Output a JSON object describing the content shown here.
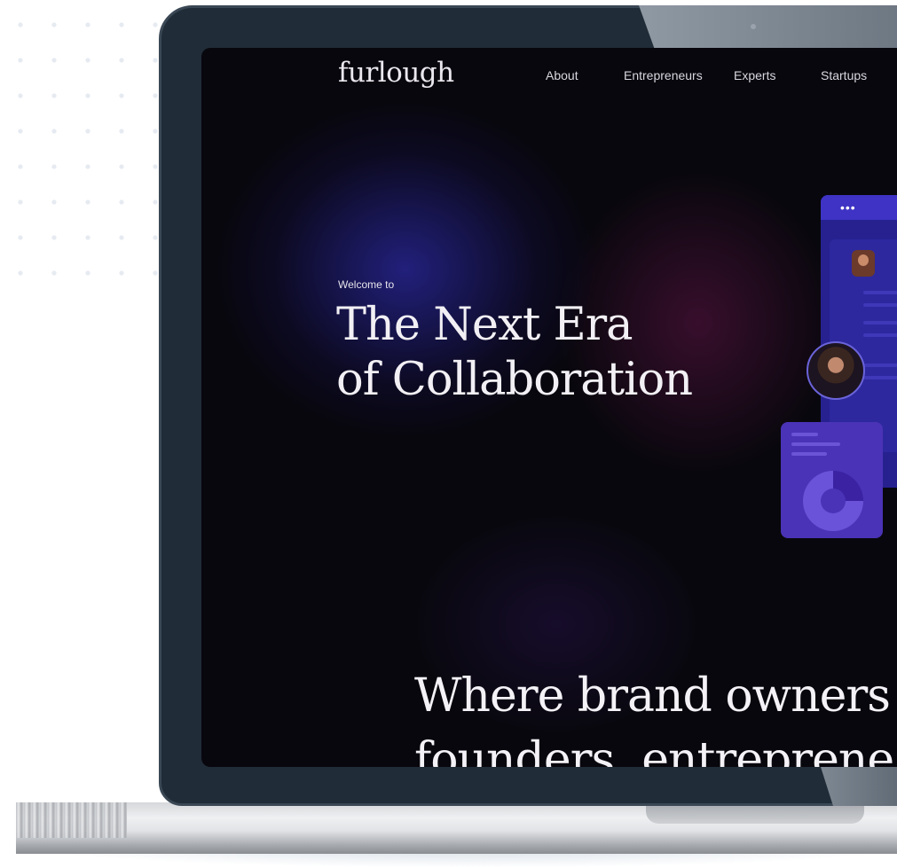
{
  "site": {
    "logo": "furlough",
    "nav": [
      "About",
      "Entrepreneurs",
      "Experts",
      "Startups"
    ]
  },
  "hero": {
    "eyebrow": "Welcome to",
    "title_line1": "The Next Era",
    "title_line2": "of Collaboration"
  },
  "section": {
    "headline_line1": "Where brand owners",
    "headline_line2": "founders, entreprene"
  },
  "mockup": {
    "window_dots": "•••"
  },
  "colors": {
    "background": "#08070d",
    "text": "#f2f0f4",
    "accent_blue": "#26218f",
    "accent_purple": "#4a33b6",
    "laptop_bezel": "#202c37"
  }
}
